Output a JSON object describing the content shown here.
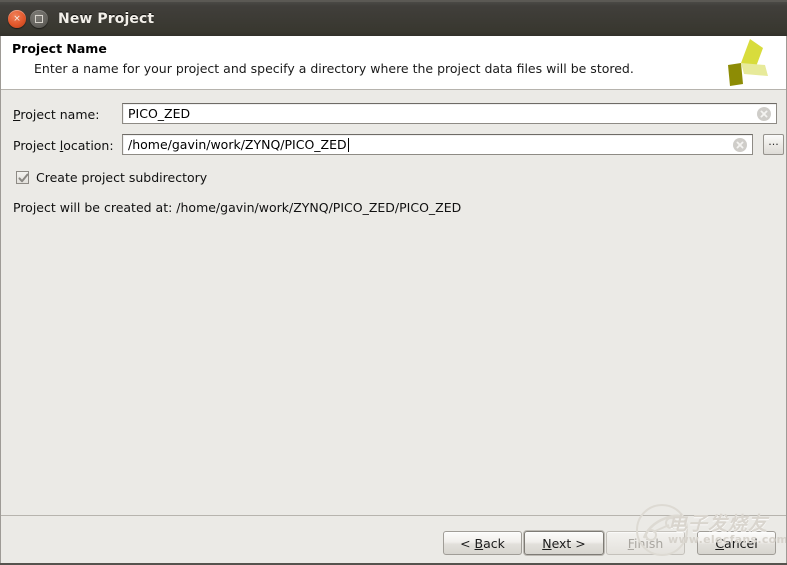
{
  "window": {
    "title": "New Project",
    "close_glyph": "×",
    "maximize_name": "maximize"
  },
  "header": {
    "title": "Project Name",
    "description": "Enter a name for your project and specify a directory where the project data files will be stored.",
    "logo_name": "xilinx-vivado-logo"
  },
  "form": {
    "project_name": {
      "label_pre": "P",
      "label_mnemonic": "",
      "label": "roject name:",
      "label_full": "Project name:",
      "value": "PICO_ZED",
      "placeholder": "",
      "clear_title": "Clear"
    },
    "project_location": {
      "label_pre": "Project ",
      "label_mnemonic": "l",
      "label_post": "ocation:",
      "label_full": "Project location:",
      "value": "/home/gavin/work/ZYNQ/PICO_ZED",
      "placeholder": "",
      "clear_title": "Clear",
      "browse_label": "..."
    },
    "create_subdirectory": {
      "label": "Create project subdirectory",
      "checked": true
    },
    "status_text": "Project will be created at: /home/gavin/work/ZYNQ/PICO_ZED/PICO_ZED"
  },
  "buttons": {
    "back": {
      "label": "< Back",
      "pre": "< ",
      "mnemonic": "B",
      "post": "ack",
      "enabled": true
    },
    "next": {
      "label": "Next >",
      "pre": "",
      "mnemonic": "N",
      "post": "ext >",
      "enabled": true,
      "focused": true
    },
    "finish": {
      "label": "Finish",
      "pre": "",
      "mnemonic": "F",
      "post": "inish",
      "enabled": false
    },
    "cancel": {
      "label": "Cancel",
      "pre": "",
      "mnemonic": "C",
      "post": "ancel",
      "enabled": true
    }
  },
  "watermark": {
    "chinese": "电子发烧友",
    "url": "www.elecfans.com"
  },
  "colors": {
    "titlebar": "#38372f",
    "close_button": "#e2572b",
    "dialog_bg": "#ebeae6",
    "header_bg": "#ffffff",
    "logo_bright": "#d8dc3c",
    "logo_dark": "#8d8c05",
    "logo_pale": "#e7ea9a"
  }
}
